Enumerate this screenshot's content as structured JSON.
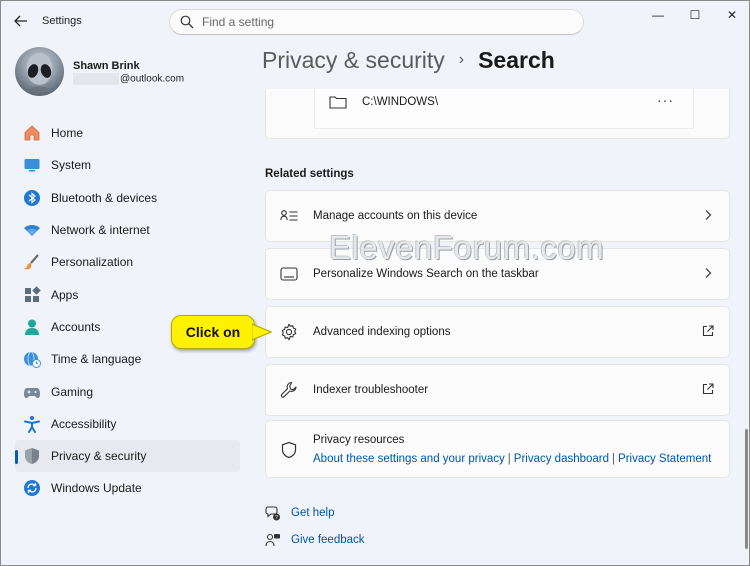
{
  "window": {
    "title": "Settings",
    "minimize": "—",
    "maximize": "☐",
    "close": "✕"
  },
  "search": {
    "placeholder": "Find a setting"
  },
  "profile": {
    "name": "Shawn Brink",
    "email_suffix": "@outlook.com"
  },
  "sidebar": {
    "items": [
      {
        "label": "Home",
        "icon": "home-icon",
        "active": false
      },
      {
        "label": "System",
        "icon": "system-icon",
        "active": false
      },
      {
        "label": "Bluetooth & devices",
        "icon": "bluetooth-icon",
        "active": false
      },
      {
        "label": "Network & internet",
        "icon": "wifi-icon",
        "active": false
      },
      {
        "label": "Personalization",
        "icon": "brush-icon",
        "active": false
      },
      {
        "label": "Apps",
        "icon": "apps-icon",
        "active": false
      },
      {
        "label": "Accounts",
        "icon": "accounts-icon",
        "active": false
      },
      {
        "label": "Time & language",
        "icon": "globe-clock-icon",
        "active": false
      },
      {
        "label": "Gaming",
        "icon": "gamepad-icon",
        "active": false
      },
      {
        "label": "Accessibility",
        "icon": "accessibility-icon",
        "active": false
      },
      {
        "label": "Privacy & security",
        "icon": "shield-icon",
        "active": true
      },
      {
        "label": "Windows Update",
        "icon": "update-icon",
        "active": false
      }
    ]
  },
  "breadcrumb": {
    "parent": "Privacy & security",
    "separator": "›",
    "current": "Search"
  },
  "excluded_folder": {
    "path": "C:\\WINDOWS\\",
    "more": "···"
  },
  "related": {
    "title": "Related settings",
    "items": [
      {
        "label": "Manage accounts on this device",
        "icon": "accounts-list-icon",
        "action": "chevron"
      },
      {
        "label": "Personalize Windows Search on the taskbar",
        "icon": "taskbar-icon",
        "action": "chevron"
      },
      {
        "label": "Advanced indexing options",
        "icon": "gear-icon",
        "action": "external"
      },
      {
        "label": "Indexer troubleshooter",
        "icon": "wrench-icon",
        "action": "external"
      }
    ]
  },
  "privacy_resources": {
    "title": "Privacy resources",
    "links": [
      "About these settings and your privacy",
      "Privacy dashboard",
      "Privacy Statement"
    ],
    "separator": "|"
  },
  "footer": {
    "get_help": "Get help",
    "give_feedback": "Give feedback"
  },
  "callout": {
    "text": "Click on",
    "color": "#fff200"
  },
  "watermark": "ElevenForum.com",
  "colors": {
    "accent": "#005fb8",
    "link": "#0056a8",
    "background": "#f0f3f9",
    "card": "#fbfbfb"
  }
}
